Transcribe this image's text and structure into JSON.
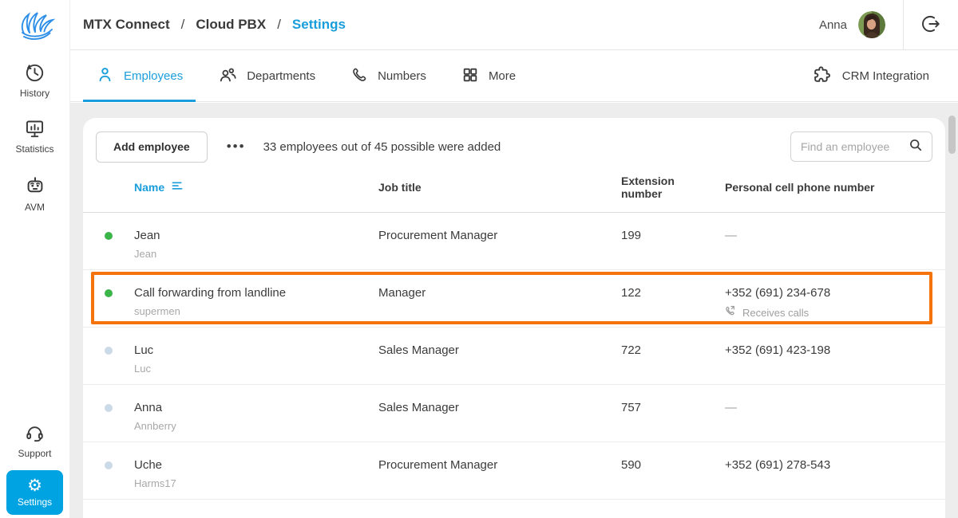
{
  "header": {
    "breadcrumb": [
      "MTX Connect",
      "Cloud PBX",
      "Settings"
    ],
    "separator": "/",
    "user_name": "Anna"
  },
  "sidebar": {
    "items": [
      {
        "label": "History"
      },
      {
        "label": "Statistics"
      },
      {
        "label": "AVM"
      },
      {
        "label": "Support"
      },
      {
        "label": "Settings",
        "active": true
      }
    ]
  },
  "tabs": {
    "items": [
      {
        "label": "Employees",
        "active": true
      },
      {
        "label": "Departments"
      },
      {
        "label": "Numbers"
      },
      {
        "label": "More"
      }
    ],
    "right_action": "CRM Integration"
  },
  "toolbar": {
    "add_button": "Add employee",
    "options_dots": "•••",
    "summary": "33 employees out of 45 possible were added",
    "search_placeholder": "Find an employee"
  },
  "table": {
    "columns": [
      "Name",
      "Job title",
      "Extension number",
      "Personal cell phone number"
    ],
    "rows": [
      {
        "name": "Jean",
        "username": "Jean",
        "job_title": "Procurement Manager",
        "extension": "199",
        "phone": "—",
        "status": "online"
      },
      {
        "name": "Call forwarding from landline",
        "username": "supermen",
        "job_title": "Manager",
        "extension": "122",
        "phone": "+352 (691) 234-678",
        "phone_note": "Receives calls",
        "status": "online",
        "highlighted": true
      },
      {
        "name": "Luc",
        "username": "Luc",
        "job_title": "Sales Manager",
        "extension": "722",
        "phone": "+352 (691) 423-198",
        "status": "offline"
      },
      {
        "name": "Anna",
        "username": "Annberry",
        "job_title": "Sales Manager",
        "extension": "757",
        "phone": "—",
        "status": "offline"
      },
      {
        "name": "Uche",
        "username": "Harms17",
        "job_title": "Procurement Manager",
        "extension": "590",
        "phone": "+352 (691) 278-543",
        "status": "offline"
      }
    ]
  },
  "colors": {
    "accent": "#1a9edb",
    "settings_tile": "#00a3e1",
    "highlight_border": "#f4740b",
    "status_online": "#3bb54a",
    "status_offline": "#ccd9e8"
  }
}
